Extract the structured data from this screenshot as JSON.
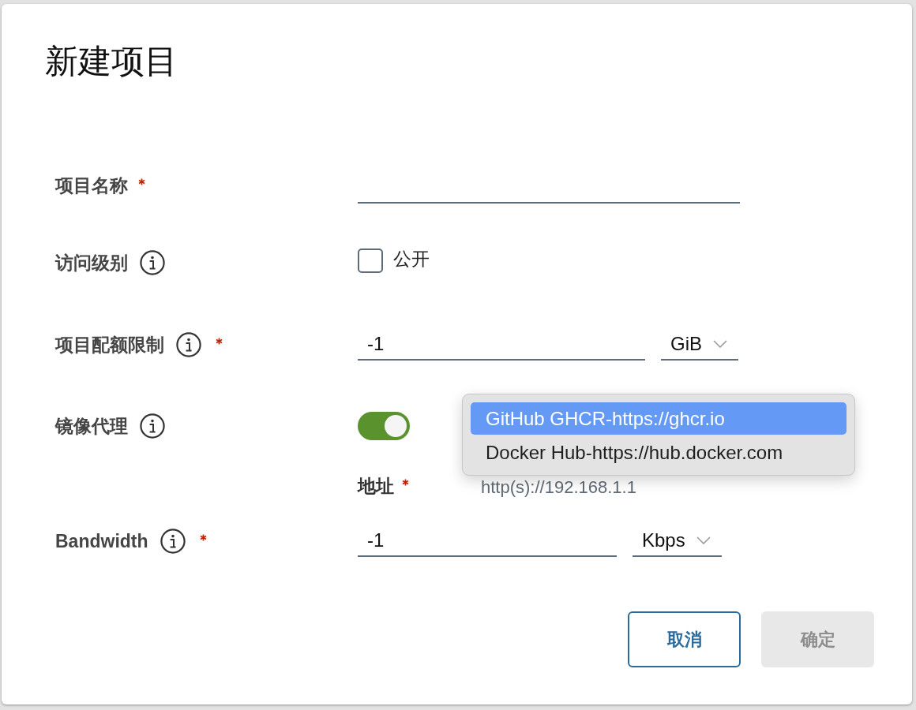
{
  "dialog": {
    "title": "新建项目"
  },
  "fields": [
    {
      "kind": "text",
      "label": "项目名称",
      "info": false,
      "required": true
    },
    {
      "kind": "checkbox",
      "label": "访问级别",
      "info": true,
      "required": false,
      "option": "公开",
      "checked": false
    },
    {
      "kind": "number_unit",
      "label": "项目配额限制",
      "info": true,
      "required": true,
      "value": "-1",
      "unit": "GiB"
    },
    {
      "kind": "toggle",
      "label": "镜像代理",
      "info": true,
      "required": false,
      "on": true,
      "address": {
        "label": "地址",
        "required": true,
        "placeholder": "http(s)://192.168.1.1",
        "suggestions": [
          {
            "label": "GitHub GHCR-https://ghcr.io",
            "selected": true
          },
          {
            "label": "Docker Hub-https://hub.docker.com",
            "selected": false
          }
        ]
      }
    },
    {
      "kind": "number_unit",
      "label": "Bandwidth",
      "info": true,
      "required": true,
      "value": "-1",
      "unit": "Kbps"
    }
  ],
  "buttons": [
    {
      "label": "取消",
      "kind": "outline",
      "disabled": false
    },
    {
      "label": "确定",
      "kind": "primary",
      "disabled": true
    }
  ]
}
